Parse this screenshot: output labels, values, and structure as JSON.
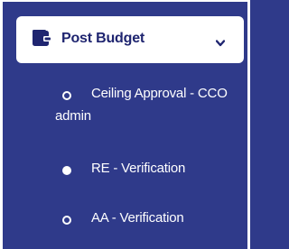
{
  "menu": {
    "header": {
      "label": "Post Budget",
      "icon": "wallet-icon",
      "expanded": true
    },
    "items": [
      {
        "label_line1": "Ceiling Approval - CCO",
        "label_line2": "admin",
        "state": "inactive",
        "icon": "circle-outline-icon"
      },
      {
        "label": "RE - Verification",
        "state": "active",
        "icon": "circle-filled-icon"
      },
      {
        "label": "AA - Verification",
        "state": "inactive",
        "icon": "circle-outline-icon"
      }
    ]
  },
  "colors": {
    "sidebar_bg": "#2f3a8a",
    "header_bg": "#ffffff",
    "header_text": "#1f2570",
    "item_text": "#ffffff"
  }
}
